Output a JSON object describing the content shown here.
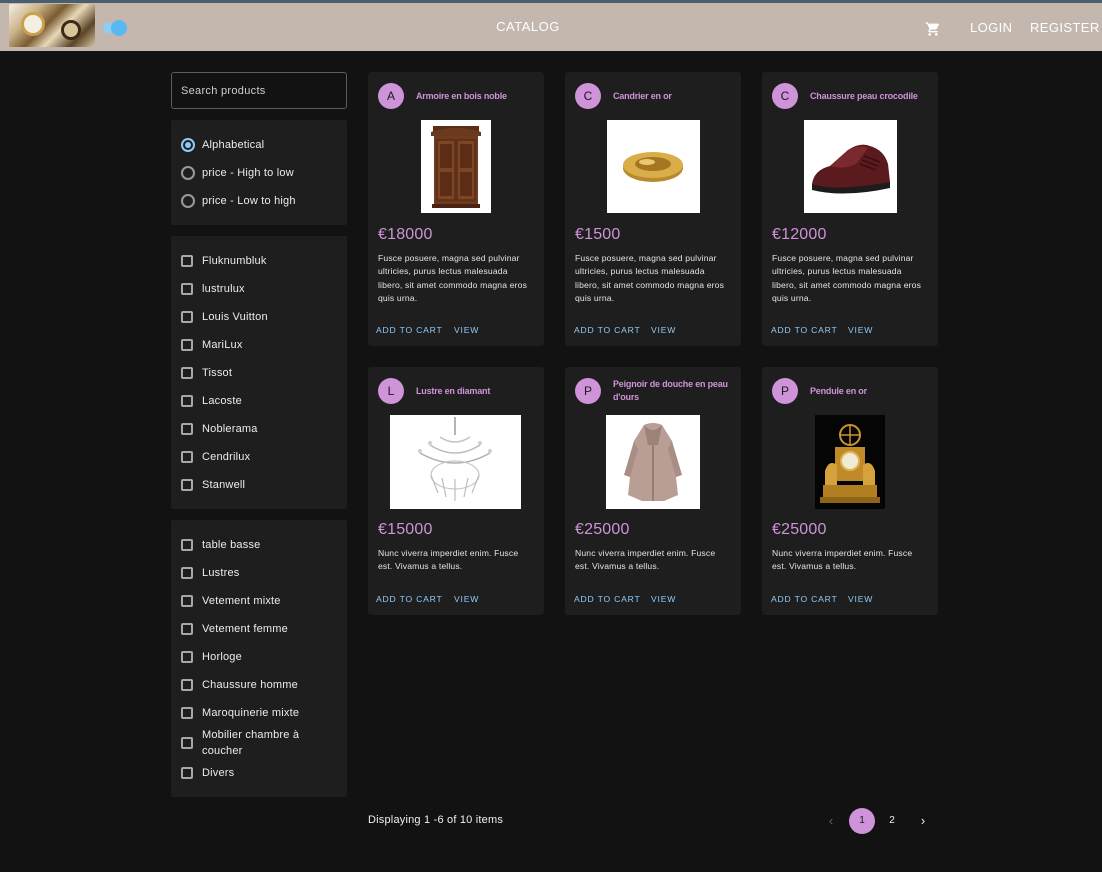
{
  "header": {
    "title": "CATALOG",
    "login": "LOGIN",
    "register": "REGISTER",
    "theme_toggle_on": true,
    "accent": "#ce93d8"
  },
  "search": {
    "placeholder": "Search products",
    "value": ""
  },
  "sort": {
    "selected": "Alphabetical",
    "options": [
      "Alphabetical",
      "price - High to low",
      "price - Low to high"
    ]
  },
  "brands": [
    "Fluknumbluk",
    "lustrulux",
    "Louis Vuitton",
    "MariLux",
    "Tissot",
    "Lacoste",
    "Noblerama",
    "Cendrilux",
    "Stanwell"
  ],
  "categories": [
    "table basse",
    "Lustres",
    "Vetement mixte",
    "Vetement femme",
    "Horloge",
    "Chaussure homme",
    "Maroquinerie mixte",
    "Mobilier chambre à coucher",
    "Divers"
  ],
  "products": [
    {
      "initial": "A",
      "title": "Armoire en bois noble",
      "price": "€18000",
      "description": "Fusce posuere, magna sed pulvinar ultricies, purus lectus malesuada libero, sit amet commodo magna eros quis urna.",
      "image": "wooden-armoire"
    },
    {
      "initial": "C",
      "title": "Candrier en or",
      "price": "€1500",
      "description": "Fusce posuere, magna sed pulvinar ultricies, purus lectus malesuada libero, sit amet commodo magna eros quis urna.",
      "image": "gold-ashtray"
    },
    {
      "initial": "C",
      "title": "Chaussure peau crocodile",
      "price": "€12000",
      "description": "Fusce posuere, magna sed pulvinar ultricies, purus lectus malesuada libero, sit amet commodo magna eros quis urna.",
      "image": "crocodile-shoe"
    },
    {
      "initial": "L",
      "title": "Lustre en diamant",
      "price": "€15000",
      "description": "Nunc viverra imperdiet enim. Fusce est. Vivamus a tellus.",
      "image": "crystal-chandelier"
    },
    {
      "initial": "P",
      "title": "Peignoir de douche en peau d'ours",
      "price": "€25000",
      "description": "Nunc viverra imperdiet enim. Fusce est. Vivamus a tellus.",
      "image": "fur-bathrobe"
    },
    {
      "initial": "P",
      "title": "Pendule en or",
      "price": "€25000",
      "description": "Nunc viverra imperdiet enim. Fusce est. Vivamus a tellus.",
      "image": "gold-clock"
    }
  ],
  "card_actions": {
    "add_to_cart": "ADD TO CART",
    "view": "VIEW"
  },
  "pagination": {
    "summary": "Displaying 1 -6 of 10 items",
    "current_page": "1",
    "pages": [
      "1",
      "2"
    ],
    "prev": "‹",
    "next": "›"
  }
}
